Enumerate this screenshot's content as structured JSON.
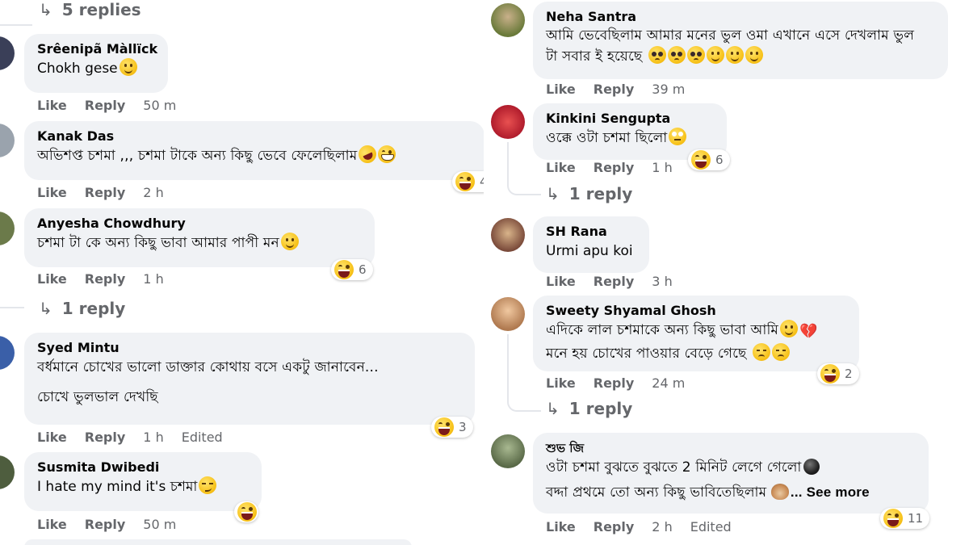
{
  "left": {
    "top_replies": "5 replies",
    "comments": [
      {
        "name": "Srêenipã Màllïck",
        "lines": [
          "Chokh gese"
        ],
        "emoji": [
          "smile"
        ],
        "like": "Like",
        "reply": "Reply",
        "time": "50 m"
      },
      {
        "name": "Kanak Das",
        "lines": [
          "অভিশপ্ত চশমা ,,, চশমা টাকে অন্য কিছু ভেবে ফেলেছিলাম"
        ],
        "emoji": [
          "rofl",
          "grin"
        ],
        "like": "Like",
        "reply": "Reply",
        "time": "2 h",
        "reaction_count": "4"
      },
      {
        "name": "Anyesha Chowdhury",
        "lines": [
          "চশমা টা কে অন্য কিছু ভাবা আমার পাপী মন"
        ],
        "emoji": [
          "smile"
        ],
        "like": "Like",
        "reply": "Reply",
        "time": "1 h",
        "reaction_count": "6",
        "replies": "1 reply"
      },
      {
        "name": "Syed Mintu",
        "lines": [
          "বর্ধমানে চোখের ভালো ডাক্তার কোথায় বসে একটু জানাবেন...",
          "চোখে ভুলভাল দেখছি"
        ],
        "like": "Like",
        "reply": "Reply",
        "time": "1 h",
        "edited": "Edited",
        "reaction_count": "3"
      },
      {
        "name": "Susmita Dwibedi",
        "lines": [
          "I hate my mind it's চশমা"
        ],
        "emoji": [
          "smirk"
        ],
        "like": "Like",
        "reply": "Reply",
        "time": "50 m"
      }
    ]
  },
  "right": {
    "comments": [
      {
        "name": "Neha Santra",
        "lines": [
          "আমি ভেবেছিলাম আমার মনের ভুল ওমা এখানে এসে দেখলাম ভুল",
          "টা সবার ই হয়েছে"
        ],
        "emoji": [
          "plead",
          "plead",
          "plead",
          "smile",
          "smile",
          "smile"
        ],
        "like": "Like",
        "reply": "Reply",
        "time": "39 m"
      },
      {
        "name": "Kinkini Sengupta",
        "lines": [
          "ওক্কে ওটা চশমা ছিলো"
        ],
        "emoji": [
          "roll"
        ],
        "like": "Like",
        "reply": "Reply",
        "time": "1 h",
        "reaction_count": "6",
        "replies": "1 reply"
      },
      {
        "name": "SH Rana",
        "lines": [
          "Urmi apu koi"
        ],
        "like": "Like",
        "reply": "Reply",
        "time": "3 h"
      },
      {
        "name": "Sweety Shyamal Ghosh",
        "lines": [
          "এদিকে লাল চশমাকে অন্য কিছু ভাবা আমি",
          "মনে হয় চোখের পাওয়ার বেড়ে গেছে"
        ],
        "emoji": [
          "smile",
          "heart",
          "sad",
          "sad"
        ],
        "like": "Like",
        "reply": "Reply",
        "time": "24 m",
        "reaction_count": "2",
        "replies": "1 reply"
      },
      {
        "name": "শুভ জি",
        "lines": [
          "ওটা চশমা বুঝতে বুঝতে 2 মিনিট লেগে গেলো",
          "বদ্দা প্রথমে তো অন্য কিছু ভাবিতেছিলাম"
        ],
        "emoji": [
          "blackball",
          "monkey"
        ],
        "see_more": "... See more",
        "like": "Like",
        "reply": "Reply",
        "time": "2 h",
        "edited": "Edited",
        "reaction_count": "11"
      }
    ]
  },
  "icons": {
    "reply_arrow": "reply-arrow-icon",
    "haha_reaction": "haha-reaction-icon"
  }
}
